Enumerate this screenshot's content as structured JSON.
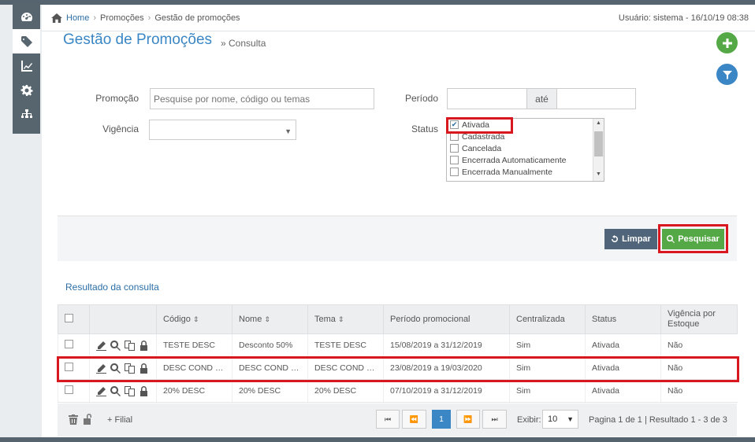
{
  "breadcrumb": {
    "home": "Home",
    "section": "Promoções",
    "page": "Gestão de promoções"
  },
  "user_info": "Usuário: sistema - 16/10/19 08:38",
  "page": {
    "title": "Gestão de Promoções",
    "subtitle": "» Consulta"
  },
  "filters": {
    "promocao_label": "Promoção",
    "promocao_placeholder": "Pesquise por nome, código ou temas",
    "vigencia_label": "Vigência",
    "periodo_label": "Período",
    "ate": "até",
    "status_label": "Status",
    "status_options": [
      {
        "label": "Ativada",
        "checked": true
      },
      {
        "label": "Cadastrada",
        "checked": false
      },
      {
        "label": "Cancelada",
        "checked": false
      },
      {
        "label": "Encerrada Automaticamente",
        "checked": false
      },
      {
        "label": "Encerrada Manualmente",
        "checked": false
      }
    ]
  },
  "buttons": {
    "limpar": "Limpar",
    "pesquisar": "Pesquisar"
  },
  "resultado_label": "Resultado da consulta",
  "table": {
    "headers": [
      "Código",
      "Nome",
      "Tema",
      "Período promocional",
      "Centralizada",
      "Status",
      "Vigência por Estoque"
    ],
    "rows": [
      {
        "codigo": "TESTE DESC",
        "nome": "Desconto 50%",
        "tema": "TESTE DESC",
        "periodo": "15/08/2019 a 31/12/2019",
        "centralizada": "Sim",
        "status": "Ativada",
        "vigencia": "Não"
      },
      {
        "codigo": "DESC COND P...",
        "nome": "DESC COND P...",
        "tema": "DESC COND P...",
        "periodo": "23/08/2019 a 19/03/2020",
        "centralizada": "Sim",
        "status": "Ativada",
        "vigencia": "Não"
      },
      {
        "codigo": "20% DESC",
        "nome": "20% DESC",
        "tema": "20% DESC",
        "periodo": "07/10/2019 a 31/12/2019",
        "centralizada": "Sim",
        "status": "Ativada",
        "vigencia": "Não"
      }
    ]
  },
  "footer": {
    "filial": "+ Filial",
    "pages": {
      "first": "⏮",
      "prev": "⏪",
      "current": "1",
      "next": "⏩",
      "last": "⏭"
    },
    "exibir_label": "Exibir:",
    "exibir_value": "10",
    "summary": "Pagina 1 de 1 | Resultado 1 - 3 de 3"
  },
  "colors": {
    "accent": "#3b86c4",
    "green": "#54a946",
    "highlight": "#d9171f",
    "sidebar": "#57656f"
  }
}
